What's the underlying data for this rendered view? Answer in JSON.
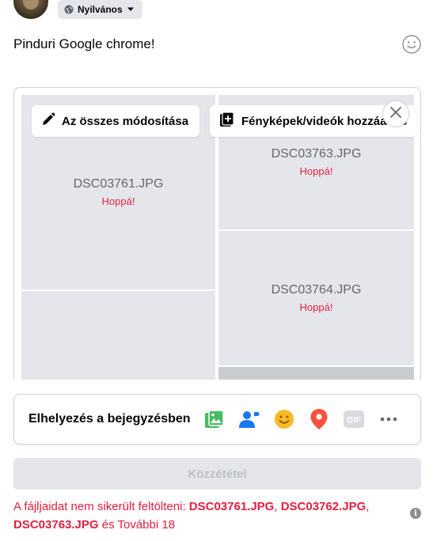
{
  "header": {
    "privacy_label": "Nyilvános"
  },
  "post": {
    "text": "Pinduri Google chrome!"
  },
  "media": {
    "edit_all_label": "Az összes módosítása",
    "add_media_label": "Fényképek/videók hozzáadás",
    "tiles": [
      {
        "filename": "DSC03761.JPG",
        "status": "Hoppá!"
      },
      {
        "filename": "DSC03763.JPG",
        "status": "Hoppá!"
      },
      {
        "filename": "DSC03764.JPG",
        "status": "Hoppá!"
      }
    ]
  },
  "add_to_post": {
    "label": "Elhelyezés a bejegyzésben",
    "icons": [
      "photo-video-icon",
      "tag-people-icon",
      "feeling-icon",
      "check-in-icon",
      "gif-icon",
      "more-icon"
    ]
  },
  "publish": {
    "label": "Közzététel"
  },
  "error": {
    "prefix": "A fájljaidat nem sikerült feltölteni: ",
    "file1": "DSC03761.JPG",
    "sep1": ", ",
    "file2": "DSC03762.JPG",
    "sep2": ",",
    "file3": "DSC03763.JPG",
    "suffix": " és További 18"
  },
  "colors": {
    "error": "#e41e3f",
    "tile_bg": "#e4e6eb",
    "button_disabled_bg": "#e4e6eb"
  }
}
